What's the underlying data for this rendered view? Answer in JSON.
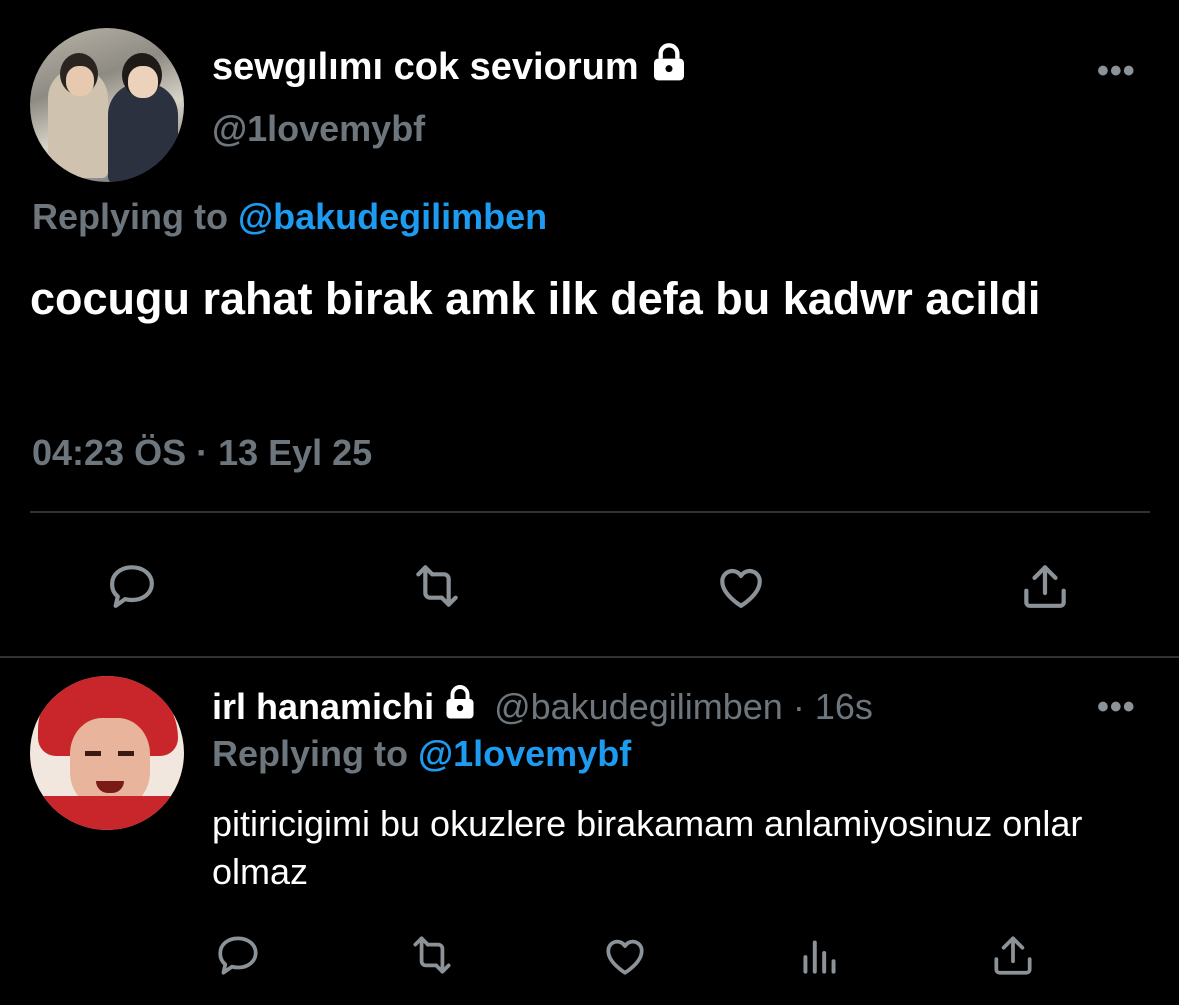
{
  "main_tweet": {
    "display_name": "sewgılımı cok seviorum",
    "handle": "@1lovemybf",
    "replying_label": "Replying to",
    "replying_to": "@bakudegilimben",
    "text": "cocugu rahat birak amk ilk defa bu kadwr acildi",
    "timestamp": "04:23 ÖS · 13 Eyl 25",
    "more_label": "•••",
    "actions": [
      "reply-icon",
      "retweet-icon",
      "like-icon",
      "share-icon"
    ]
  },
  "reply_tweet": {
    "display_name": "irl hanamichi",
    "handle": "@bakudegilimben",
    "separator": "·",
    "time_ago": "16s",
    "replying_label": "Replying to",
    "replying_to": "@1lovemybf",
    "text": "pitiricigimi bu okuzlere birakamam anlamiyosinuz onlar olmaz",
    "more_label": "•••",
    "actions": [
      "reply-icon",
      "retweet-icon",
      "like-icon",
      "analytics-icon",
      "share-icon"
    ]
  },
  "colors": {
    "background": "#000000",
    "text": "#ffffff",
    "secondary": "#6e767d",
    "link": "#1d9bf0",
    "divider": "#2f3336"
  }
}
